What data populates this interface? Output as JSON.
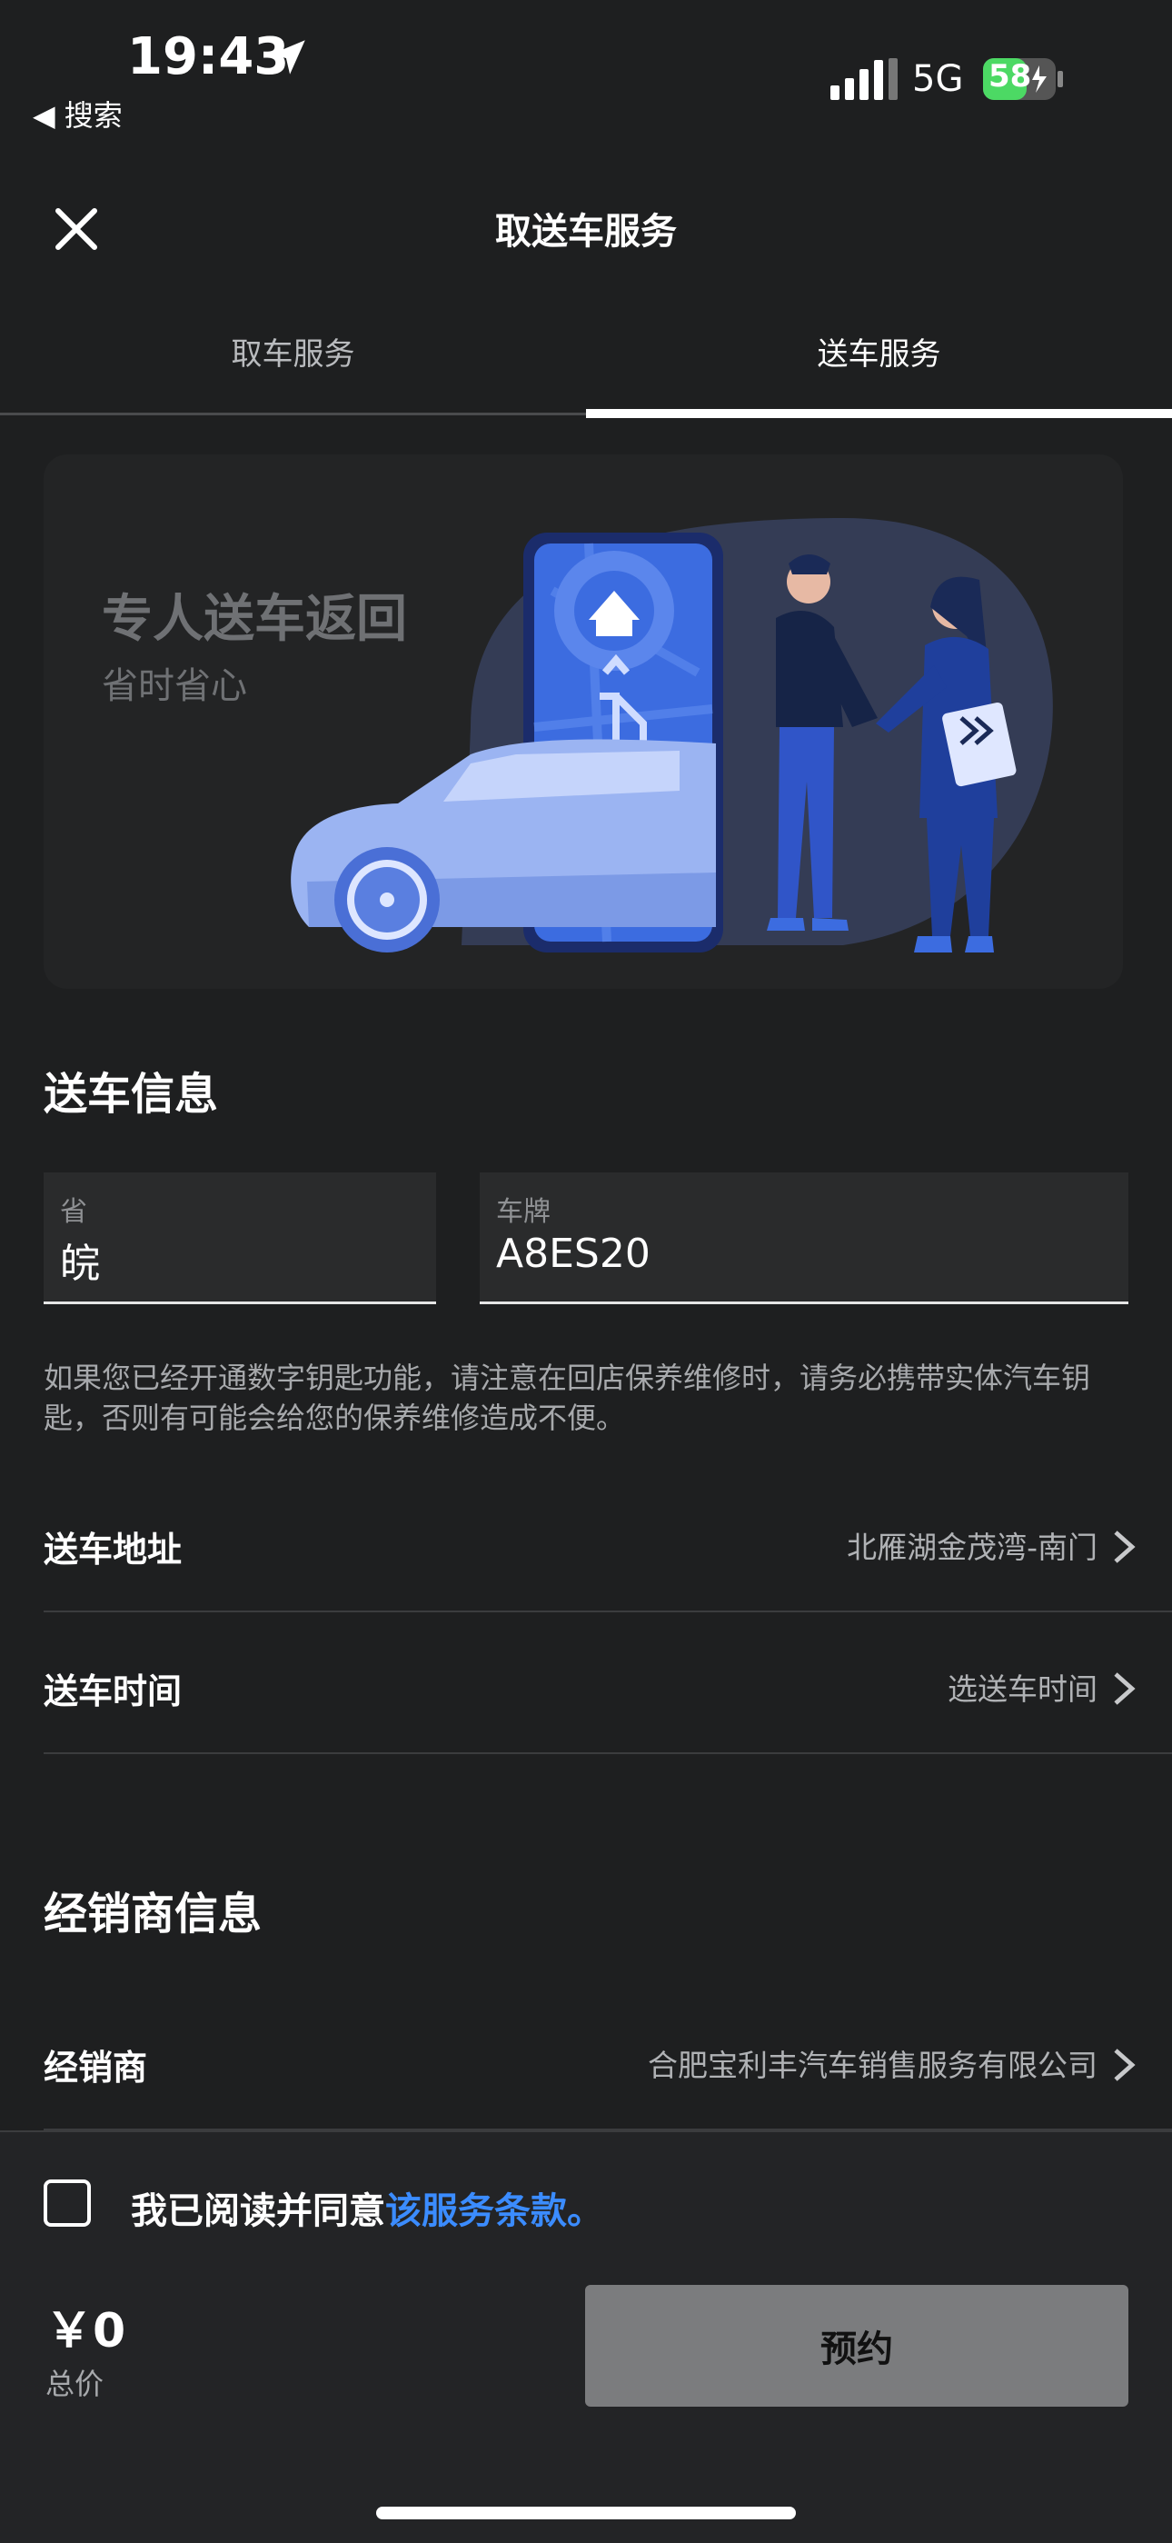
{
  "status": {
    "time": "19:43",
    "back_label": "◀ 搜索",
    "network": "5G",
    "battery": "58"
  },
  "nav": {
    "title": "取送车服务"
  },
  "tabs": [
    {
      "label": "取车服务",
      "active": false
    },
    {
      "label": "送车服务",
      "active": true
    }
  ],
  "banner": {
    "title": "专人送车返回",
    "subtitle": "省时省心"
  },
  "delivery": {
    "heading": "送车信息",
    "province": {
      "label": "省",
      "value": "皖"
    },
    "plate": {
      "label": "车牌",
      "value": "A8ES20"
    },
    "note": "如果您已经开通数字钥匙功能，请注意在回店保养维修时，请务必携带实体汽车钥匙，否则有可能会给您的保养维修造成不便。",
    "address": {
      "label": "送车地址",
      "value": "北雁湖金茂湾-南门"
    },
    "time": {
      "label": "送车时间",
      "value": "选送车时间"
    }
  },
  "dealer": {
    "heading": "经销商信息",
    "dealer": {
      "label": "经销商",
      "value": "合肥宝利丰汽车销售服务有限公司"
    }
  },
  "footer": {
    "agree_prefix": "我已阅读并同意",
    "agree_link": "该服务条款。",
    "price": "￥0",
    "price_label": "总价",
    "book_label": "预约"
  },
  "colors": {
    "background": "#1e1f20",
    "accent_link": "#3b8cff",
    "button_disabled": "#7b7c7e",
    "battery": "#4cd964"
  }
}
